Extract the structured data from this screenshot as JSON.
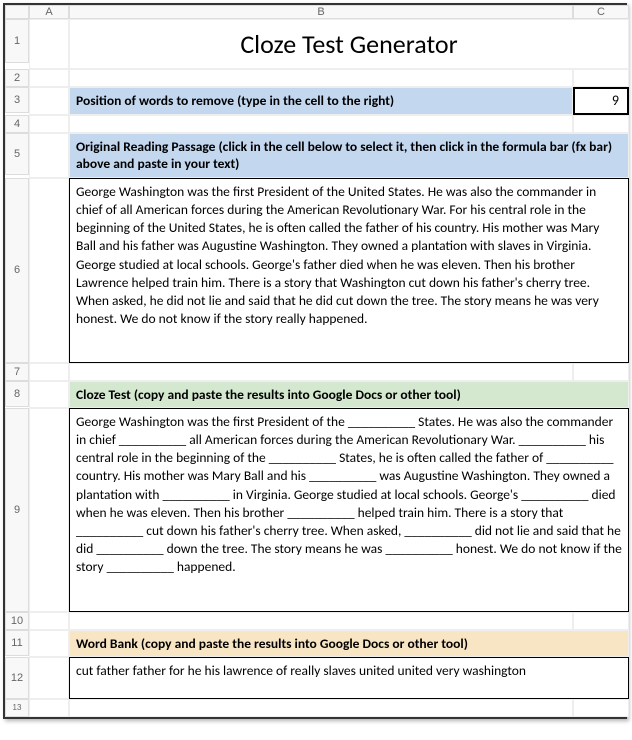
{
  "columns": [
    "A",
    "B",
    "C"
  ],
  "rows": [
    "1",
    "2",
    "3",
    "4",
    "5",
    "6",
    "7",
    "8",
    "9",
    "10",
    "11",
    "12",
    "13"
  ],
  "title": "Cloze Test Generator",
  "sections": {
    "position": {
      "label": "Position of words to remove (type in the cell to the right)",
      "value": "9"
    },
    "original": {
      "label": "Original Reading Passage (click in the cell below to select it, then click in the formula bar (fx bar) above and paste in your text)",
      "text": "George Washington was the first President of the United States. He was also the commander in chief of all American forces during the American Revolutionary War. For his central role in the beginning of the United States, he is often called the father of his country. His mother was Mary Ball and his father was Augustine Washington. They owned a plantation with slaves in Virginia. George studied at local schools. George's father died when he was eleven. Then his brother Lawrence helped train him. There is a story that Washington cut down his father's cherry tree. When asked, he did not lie and said that he did cut down the tree. The story means he was very honest. We do not know if the story really happened."
    },
    "cloze": {
      "label": "Cloze Test (copy and paste the results into Google Docs or other tool)",
      "text": "George Washington was the first President of the __________ States. He was also the commander in chief __________ all American forces during the American Revolutionary War. __________ his central role in the beginning of the __________ States, he is often called the father of __________ country. His mother was Mary Ball and his __________ was Augustine Washington. They owned a plantation with __________ in Virginia. George studied at local schools. George's __________ died when he was eleven. Then his brother __________ helped train him. There is a story that __________ cut down his father's cherry tree. When asked, __________ did not lie and said that he did __________ down the tree. The story means he was __________ honest. We do not know if the story __________ happened."
    },
    "wordbank": {
      "label": "Word Bank (copy and paste the results into Google Docs or other tool)",
      "text": "cut father father for he his lawrence of really slaves united united very washington"
    }
  },
  "chart_data": {
    "type": "table",
    "title": "Cloze Test Generator",
    "position_value": 9,
    "removed_words": [
      "cut",
      "father",
      "father",
      "for",
      "he",
      "his",
      "lawrence",
      "of",
      "really",
      "slaves",
      "united",
      "united",
      "very",
      "washington"
    ]
  }
}
